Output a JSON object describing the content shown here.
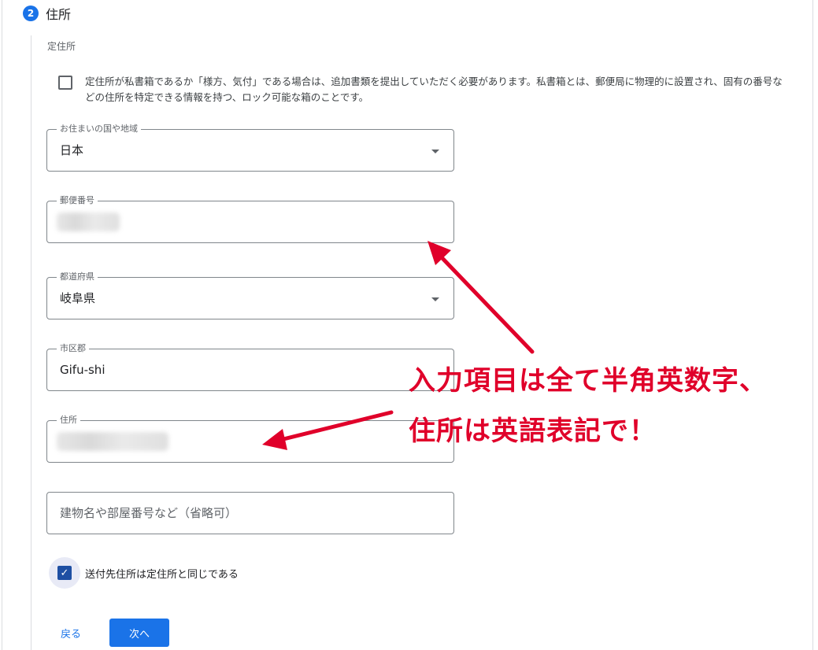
{
  "step": {
    "number": "2",
    "title": "住所"
  },
  "section_label": "定住所",
  "po_box_notice": {
    "checked": false,
    "text": "定住所が私書箱であるか「様方、気付」である場合は、追加書類を提出していただく必要があります。私書箱とは、郵便局に物理的に設置され、固有の番号などの住所を特定できる情報を持つ、ロック可能な箱のことです。"
  },
  "fields": {
    "country": {
      "label": "お住まいの国や地域",
      "value": "日本"
    },
    "postal_code": {
      "label": "郵便番号"
    },
    "prefecture": {
      "label": "都道府県",
      "value": "岐阜県"
    },
    "city": {
      "label": "市区郡",
      "value": "Gifu-shi"
    },
    "address": {
      "label": "住所"
    },
    "building": {
      "placeholder": "建物名や部屋番号など（省略可）"
    }
  },
  "same_address": {
    "checked": true,
    "label": "送付先住所は定住所と同じである"
  },
  "buttons": {
    "back": "戻る",
    "next": "次へ"
  },
  "annotation": {
    "line1": "入力項目は全て半角英数字、",
    "line2": "住所は英語表記で！",
    "color": "#e0002a"
  },
  "colors": {
    "accent": "#1a73e8",
    "checkbox": "#1e4fa3"
  }
}
